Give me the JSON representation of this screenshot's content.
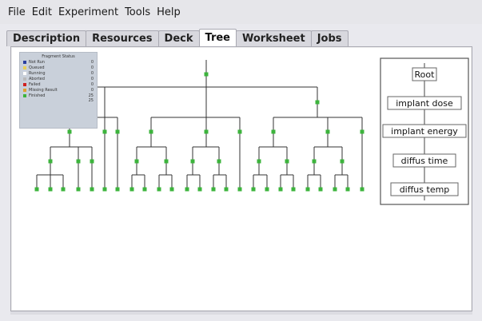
{
  "menubar": {
    "items": [
      "File",
      "Edit",
      "Experiment",
      "Tools",
      "Help"
    ]
  },
  "tabs": [
    {
      "label": "Description",
      "active": false
    },
    {
      "label": "Resources",
      "active": false
    },
    {
      "label": "Deck",
      "active": false
    },
    {
      "label": "Tree",
      "active": true
    },
    {
      "label": "Worksheet",
      "active": false
    },
    {
      "label": "Jobs",
      "active": false
    }
  ],
  "legend": {
    "title": "Fragment Status",
    "rows": [
      {
        "label": "Not Run",
        "count": "0",
        "color": "#2a3fa0"
      },
      {
        "label": "Queued",
        "count": "0",
        "color": "#e8d05a"
      },
      {
        "label": "Running",
        "count": "0",
        "color": "#ffffff"
      },
      {
        "label": "Aborted",
        "count": "0",
        "color": "#b9b9b9"
      },
      {
        "label": "Failed",
        "count": "0",
        "color": "#d02020"
      },
      {
        "label": "Missing Result",
        "count": "0",
        "color": "#e0a030"
      },
      {
        "label": "Finished",
        "count": "25",
        "color": "#3cb43c"
      }
    ],
    "total": "25"
  },
  "hierarchy": {
    "levels": [
      "Root",
      "implant dose",
      "implant energy",
      "diffus time",
      "diffus temp"
    ]
  },
  "colors": {
    "node": "#3cb43c",
    "line": "#333333",
    "panel_bg": "#ffffff"
  }
}
